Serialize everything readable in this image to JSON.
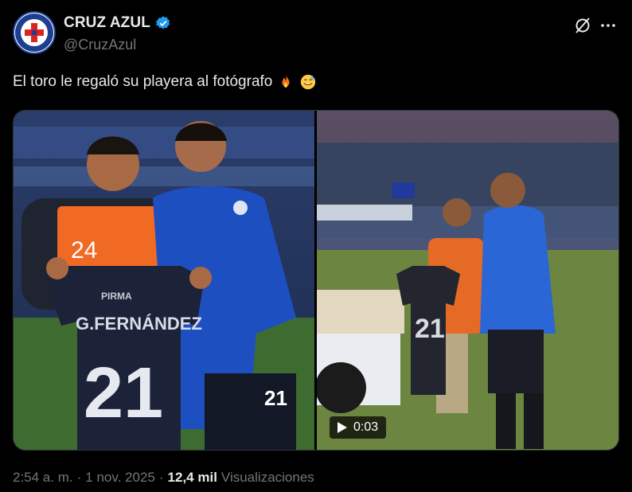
{
  "account": {
    "display_name": "CRUZ AZUL",
    "handle": "@CruzAzul",
    "avatar_icon": "cruz-azul-crest-icon",
    "verified_icon": "verified-badge-icon",
    "verified_color": "#1d9bf0"
  },
  "actions": {
    "grok_icon": "grok-icon",
    "more_icon": "more-options-icon"
  },
  "tweet": {
    "text": "El toro le regaló su playera al fotógrafo",
    "emojis": [
      "fire-emoji",
      "sweat-smile-emoji"
    ]
  },
  "media": {
    "photo_jersey_name": "G.FERNÁNDEZ",
    "photo_jersey_number": "21",
    "photo_sponsor": "PIRMA",
    "photo_vest_number": "24",
    "video_duration": "0:03",
    "video_play_icon": "play-icon"
  },
  "meta": {
    "time": "2:54 a. m.",
    "separator": "·",
    "date": "1 nov. 2025",
    "views_count": "12,4 mil",
    "views_label": "Visualizaciones"
  },
  "colors": {
    "background": "#000000",
    "text_primary": "#e7e9ea",
    "text_secondary": "#71767b",
    "brand_blue": "#1d3f8f"
  }
}
